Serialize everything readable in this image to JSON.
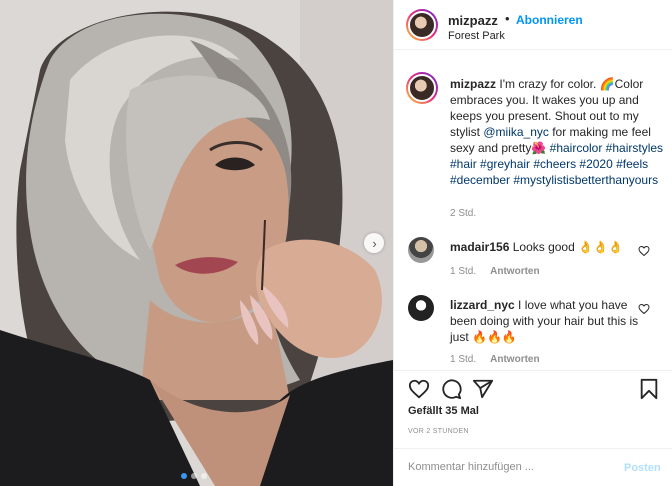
{
  "post": {
    "username": "mizpazz",
    "separator": "•",
    "follow_label": "Abonnieren",
    "location": "Forest Park",
    "colors": {
      "accent": "#0095f6",
      "link": "#00376b",
      "muted": "#8e8e8e",
      "text": "#262626"
    }
  },
  "caption": {
    "username": "mizpazz",
    "text_1": "I'm crazy for color. 🌈Color embraces you. It wakes you up and keeps you present. Shout out to my stylist ",
    "mention": "@miika_nyc",
    "text_2": " for making me feel sexy and pretty🌺 ",
    "hashtags": "#haircolor #hairstyles #hair #greyhair #cheers #2020 #feels #december #mystylistisbetterthanyours",
    "time": "2 Std."
  },
  "comments": [
    {
      "username": "madair156",
      "text": "Looks good 👌👌👌",
      "time": "1 Std.",
      "reply_label": "Antworten"
    },
    {
      "username": "lizzard_nyc",
      "text": "I love what you have been doing with your hair but this is just 🔥🔥🔥",
      "time": "1 Std.",
      "reply_label": "Antworten"
    }
  ],
  "actions": {
    "icons": [
      "heart-icon",
      "comment-icon",
      "share-icon",
      "bookmark-icon"
    ],
    "likes_label": "Gefällt 35 Mal",
    "posted_ago": "VOR 2 STUNDEN"
  },
  "add_comment": {
    "placeholder": "Kommentar hinzufügen ...",
    "post_label": "Posten"
  },
  "carousel": {
    "current_slide": 1,
    "total_slides": 3
  }
}
